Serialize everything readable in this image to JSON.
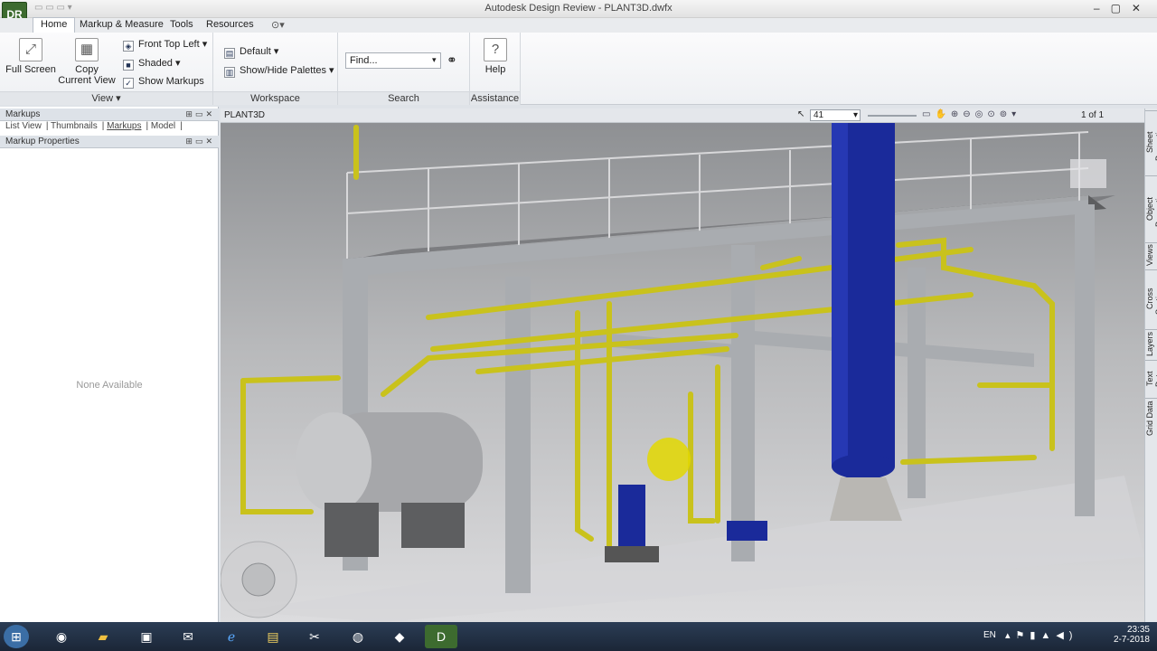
{
  "window": {
    "title": "Autodesk Design Review - PLANT3D.dwfx",
    "app_icon": "DR"
  },
  "tabs": [
    {
      "label": "Home",
      "active": true
    },
    {
      "label": "Markup & Measure"
    },
    {
      "label": "Tools"
    },
    {
      "label": "Resources"
    }
  ],
  "ribbon": {
    "view_panel": {
      "full_screen": "Full Screen",
      "copy_view": "Copy Current View",
      "front_top_left": "Front Top Left",
      "shaded": "Shaded",
      "show_markups": "Show Markups",
      "label": "View"
    },
    "workspace_panel": {
      "default": "Default",
      "show_hide": "Show/Hide Palettes",
      "label": "Workspace"
    },
    "search_panel": {
      "placeholder": "Find...",
      "label": "Search"
    },
    "assistance_panel": {
      "help": "Help",
      "label": "Assistance"
    }
  },
  "left": {
    "markups_header": "Markups",
    "subtabs": [
      "List View",
      "Thumbnails",
      "Markups",
      "Model"
    ],
    "props_header": "Markup Properties",
    "none": "None Available"
  },
  "canvas": {
    "sheet_name": "PLANT3D",
    "zoom_value": "41",
    "page": "1 of 1"
  },
  "right_tabs": [
    "Sheet Properties",
    "Object Properties",
    "Views",
    "Cross Sections",
    "Layers",
    "Text Data",
    "Grid Data"
  ],
  "taskbar": {
    "lang": "EN",
    "time": "23:35",
    "date": "2-7-2018"
  },
  "colors": {
    "column": "#1a2a9a",
    "pipe": "#c9c21c",
    "steel": "#b5b8bc"
  }
}
